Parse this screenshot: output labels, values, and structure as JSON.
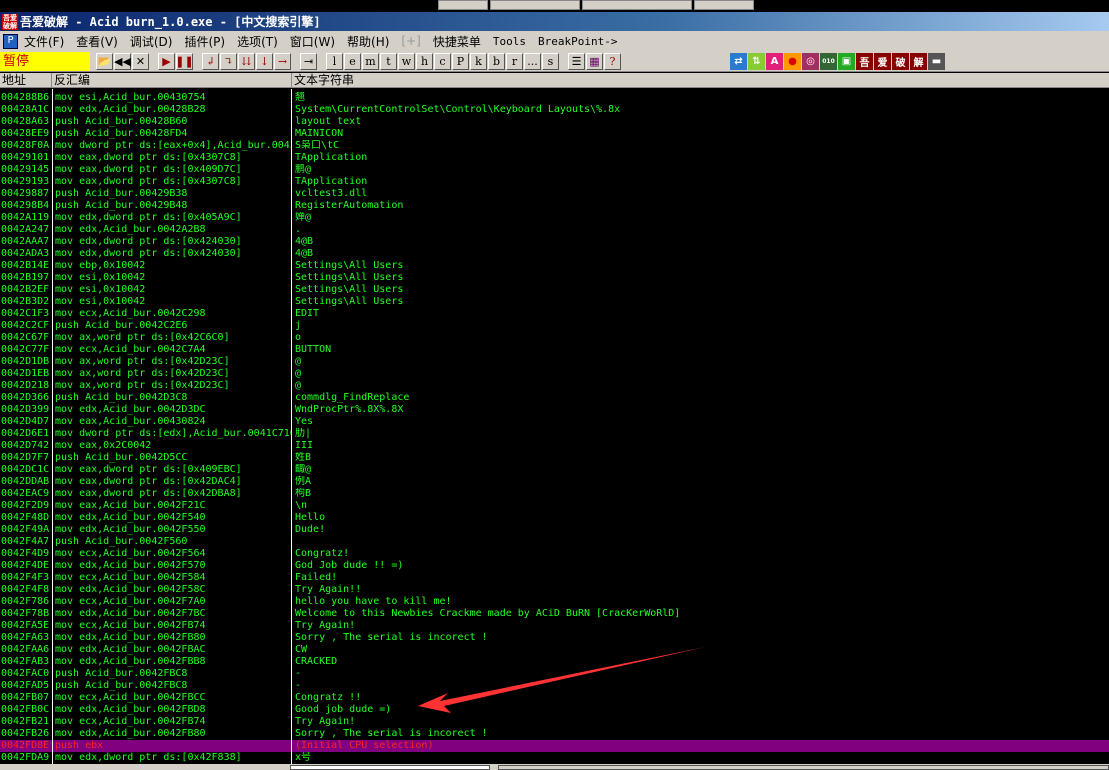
{
  "title": "吾爱破解 - Acid burn_1.0.exe - [中文搜索引擎]",
  "menu": [
    "文件(F)",
    "查看(V)",
    "调试(D)",
    "插件(P)",
    "选项(T)",
    "窗口(W)",
    "帮助(H)",
    "[+]",
    "快捷菜单",
    "Tools",
    "BreakPoint->"
  ],
  "status": "暂停",
  "letters": [
    "l",
    "e",
    "m",
    "t",
    "w",
    "h",
    "c",
    "P",
    "k",
    "b",
    "r",
    "...",
    "s"
  ],
  "brand_icons": [
    "吾",
    "爱",
    "破",
    "解"
  ],
  "columns": {
    "addr": "地址",
    "disasm": "反汇编",
    "text": "文本字符串"
  },
  "rows": [
    [
      "004288B6",
      "mov esi,Acid_bur.00430754",
      "翘"
    ],
    [
      "00428A1C",
      "mov edx,Acid_bur.00428B28",
      "System\\CurrentControlSet\\Control\\Keyboard Layouts\\%.8x"
    ],
    [
      "00428A63",
      "push Acid_bur.00428B60",
      "layout text"
    ],
    [
      "00428EE9",
      "push Acid_bur.00428FD4",
      "MAINICON"
    ],
    [
      "00428F0A",
      "mov dword ptr ds:[eax+0x4],Acid_bur.0042",
      "S枭口\\tC"
    ],
    [
      "00429101",
      "mov eax,dword ptr ds:[0x4307C8]",
      "TApplication"
    ],
    [
      "00429145",
      "mov eax,dword ptr ds:[0x409D7C]",
      "鹏@"
    ],
    [
      "00429193",
      "mov eax,dword ptr ds:[0x4307C8]",
      "TApplication"
    ],
    [
      "00429887",
      "push Acid_bur.00429B38",
      "vcltest3.dll"
    ],
    [
      "004298B4",
      "push Acid_bur.00429B48",
      "RegisterAutomation"
    ],
    [
      "0042A119",
      "mov edx,dword ptr ds:[0x405A9C]",
      "婵@"
    ],
    [
      "0042A247",
      "mov edx,Acid_bur.0042A2B8",
      "."
    ],
    [
      "0042AAA7",
      "mov edx,dword ptr ds:[0x424030]",
      "4@B"
    ],
    [
      "0042ADA3",
      "mov edx,dword ptr ds:[0x424030]",
      "4@B"
    ],
    [
      "0042B14E",
      "mov ebp,0x10042",
      "Settings\\All Users"
    ],
    [
      "0042B197",
      "mov esi,0x10042",
      "Settings\\All Users"
    ],
    [
      "0042B2EF",
      "mov esi,0x10042",
      "Settings\\All Users"
    ],
    [
      "0042B3D2",
      "mov esi,0x10042",
      "Settings\\All Users"
    ],
    [
      "0042C1F3",
      "mov ecx,Acid_bur.0042C298",
      "EDIT"
    ],
    [
      "0042C2CF",
      "push Acid_bur.0042C2E6",
      "j"
    ],
    [
      "0042C67F",
      "mov ax,word ptr ds:[0x42C6C0]",
      "o"
    ],
    [
      "0042C77F",
      "mov ecx,Acid_bur.0042C7A4",
      "BUTTON"
    ],
    [
      "0042D1DB",
      "mov ax,word ptr ds:[0x42D23C]",
      "@"
    ],
    [
      "0042D1EB",
      "mov ax,word ptr ds:[0x42D23C]",
      "@"
    ],
    [
      "0042D218",
      "mov ax,word ptr ds:[0x42D23C]",
      "@"
    ],
    [
      "0042D366",
      "push Acid_bur.0042D3C8",
      "commdlg_FindReplace"
    ],
    [
      "0042D399",
      "mov edx,Acid_bur.0042D3DC",
      "WndProcPtr%.8X%.8X"
    ],
    [
      "0042D4D7",
      "mov eax,Acid_bur.00430824",
      "Yes"
    ],
    [
      "0042D6E1",
      "mov dword ptr ds:[edx],Acid_bur.0041C710",
      "肋|"
    ],
    [
      "0042D742",
      "mov eax,0x2C0042",
      "III"
    ],
    [
      "0042D7F7",
      "push Acid_bur.0042D5CC",
      "姓B"
    ],
    [
      "0042DC1C",
      "mov eax,dword ptr ds:[0x409EBC]",
      "齱@"
    ],
    [
      "0042DDAB",
      "mov eax,dword ptr ds:[0x42DAC4]",
      "例A"
    ],
    [
      "0042EAC9",
      "mov eax,dword ptr ds:[0x42DBA8]",
      "枸B"
    ],
    [
      "0042F2D9",
      "mov eax,Acid_bur.0042F21C",
      "\\n"
    ],
    [
      "0042F48D",
      "mov edx,Acid_bur.0042F540",
      "Hello"
    ],
    [
      "0042F49A",
      "mov edx,Acid_bur.0042F550",
      "Dude!"
    ],
    [
      "0042F4A7",
      "push Acid_bur.0042F560",
      ""
    ],
    [
      "0042F4D9",
      "mov ecx,Acid_bur.0042F564",
      "Congratz!"
    ],
    [
      "0042F4DE",
      "mov edx,Acid_bur.0042F570",
      "God Job dude !! =)"
    ],
    [
      "0042F4F3",
      "mov ecx,Acid_bur.0042F584",
      "Failed!"
    ],
    [
      "0042F4F8",
      "mov edx,Acid_bur.0042F58C",
      "Try Again!!"
    ],
    [
      "0042F786",
      "mov ecx,Acid_bur.0042F7A0",
      "hello you have to kill me!"
    ],
    [
      "0042F78B",
      "mov edx,Acid_bur.0042F7BC",
      "Welcome to this Newbies Crackme made by ACiD BuRN [CracKerWoRlD]"
    ],
    [
      "0042FA5E",
      "mov ecx,Acid_bur.0042FB74",
      "Try Again!"
    ],
    [
      "0042FA63",
      "mov edx,Acid_bur.0042FB80",
      "Sorry , The serial is incorect !"
    ],
    [
      "0042FAA6",
      "mov edx,Acid_bur.0042FBAC",
      "CW"
    ],
    [
      "0042FAB3",
      "mov edx,Acid_bur.0042FBB8",
      "CRACKED"
    ],
    [
      "0042FAC0",
      "push Acid_bur.0042FBC8",
      "-"
    ],
    [
      "0042FAD5",
      "push Acid_bur.0042FBC8",
      "-"
    ],
    [
      "0042FB07",
      "mov ecx,Acid_bur.0042FBCC",
      "Congratz !!"
    ],
    [
      "0042FB0C",
      "mov edx,Acid_bur.0042FBD8",
      "Good job dude =)"
    ],
    [
      "0042FB21",
      "mov ecx,Acid_bur.0042FB74",
      "Try Again!"
    ],
    [
      "0042FB26",
      "mov edx,Acid_bur.0042FB80",
      "Sorry , The serial is incorect !"
    ],
    [
      "0042FD8E",
      "push ebx",
      "(Initial CPU selection)"
    ],
    [
      "0042FDA9",
      "mov edx,dword ptr ds:[0x42F838]",
      "x号"
    ]
  ],
  "selected_row": 54,
  "colors": {
    "text": "#22ff22",
    "selected_bg": "#800080",
    "selected_fg": "#ff2222",
    "status_bg": "#ffff00"
  }
}
